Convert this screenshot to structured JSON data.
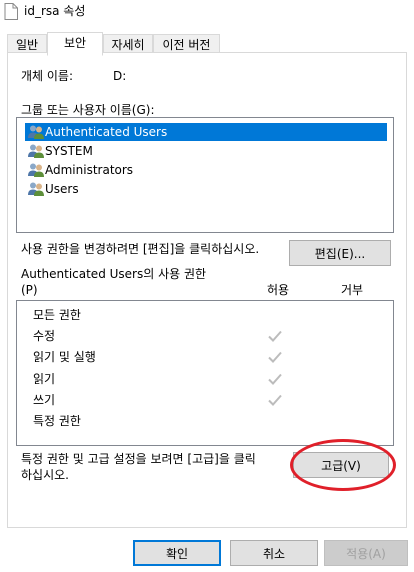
{
  "window": {
    "title": "id_rsa 속성"
  },
  "tabs": [
    {
      "label": "일반",
      "active": false
    },
    {
      "label": "보안",
      "active": true
    },
    {
      "label": "자세히",
      "active": false
    },
    {
      "label": "이전 버전",
      "active": false
    }
  ],
  "object": {
    "label": "개체 이름:",
    "value": "D:"
  },
  "groups": {
    "label": "그룹 또는 사용자 이름(G):",
    "items": [
      {
        "label": "Authenticated Users",
        "selected": true
      },
      {
        "label": "SYSTEM",
        "selected": false
      },
      {
        "label": "Administrators",
        "selected": false
      },
      {
        "label": "Users",
        "selected": false
      }
    ]
  },
  "edit": {
    "hint": "사용 권한을 변경하려면 [편집]을 클릭하십시오.",
    "button": "편집(E)..."
  },
  "permissions": {
    "title": "Authenticated Users의 사용 권한",
    "shortcut": "(P)",
    "allow_header": "허용",
    "deny_header": "거부",
    "rows": [
      {
        "label": "모든 권한",
        "allow": false
      },
      {
        "label": "수정",
        "allow": true
      },
      {
        "label": "읽기 및 실행",
        "allow": true
      },
      {
        "label": "읽기",
        "allow": true
      },
      {
        "label": "쓰기",
        "allow": true
      },
      {
        "label": "특정 권한",
        "allow": false
      }
    ]
  },
  "advanced": {
    "hint_line1": "특정 권한 및 고급 설정을 보려면 [고급]을 클릭",
    "hint_line2": "하십시오.",
    "button": "고급(V)"
  },
  "footer": {
    "ok": "확인",
    "cancel": "취소",
    "apply": "적용(A)"
  },
  "colors": {
    "selection": "#0078d7",
    "annotation": "#e0202a",
    "check": "#bcbcbc"
  }
}
